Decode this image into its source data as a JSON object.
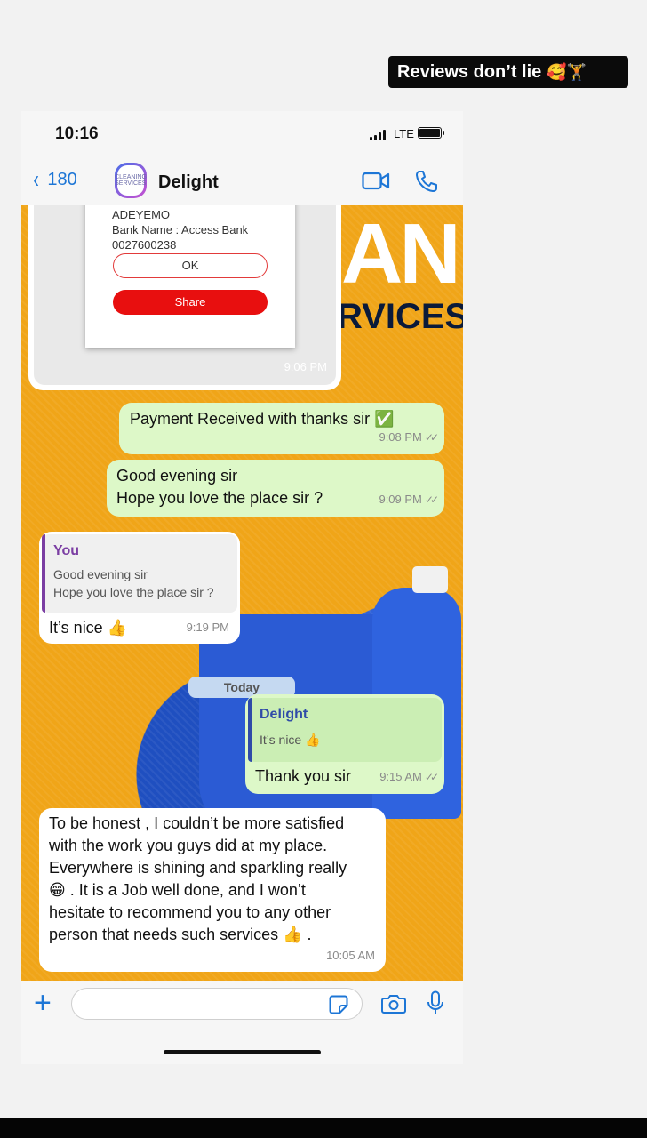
{
  "story": {
    "caption": "Reviews don’t lie",
    "emojis": "🥰🏋"
  },
  "status_bar": {
    "time": "10:16",
    "network": "LTE"
  },
  "header": {
    "back_count": "180",
    "contact_name": "Delight",
    "avatar_text": "CLEANING SERVICES"
  },
  "background": {
    "line1": "AN",
    "line2": "RVICES"
  },
  "messages": {
    "receipt": {
      "account_name": "ADEYEMO",
      "bank_name": "Bank Name : Access Bank",
      "account_number": "0027600238",
      "ok_label": "OK",
      "share_label": "Share",
      "time": "9:06 PM"
    },
    "m1": {
      "text": "Payment Received with thanks sir ✅",
      "time": "9:08 PM"
    },
    "m2": {
      "line1": "Good evening sir",
      "line2": "Hope you love the place sir ?",
      "time": "9:09 PM"
    },
    "m3": {
      "quote_author": "You",
      "quote_line1": "Good evening sir",
      "quote_line2": "Hope you love the place sir ?",
      "text": "It’s nice 👍",
      "time": "9:19 PM"
    },
    "date_separator": "Today",
    "m4": {
      "quote_author": "Delight",
      "quote_text": "It’s nice 👍",
      "text": "Thank you sir",
      "time": "9:15 AM"
    },
    "m5": {
      "line1": "To be honest , I couldn’t be more satisfied",
      "line2": "with the work you guys did at my place.",
      "line3": "Everywhere is shining and sparkling really",
      "line4": "😁 . It is a Job well done, and I won’t",
      "line5": "hesitate to recommend you to any other",
      "line6": "person that needs such services 👍 .",
      "time": "10:05 AM"
    }
  },
  "input": {
    "value": "",
    "placeholder": ""
  },
  "colors": {
    "accent": "#1d76d6",
    "outgoing_bubble": "#ddf8c8",
    "wallpaper": "#f0a518"
  }
}
